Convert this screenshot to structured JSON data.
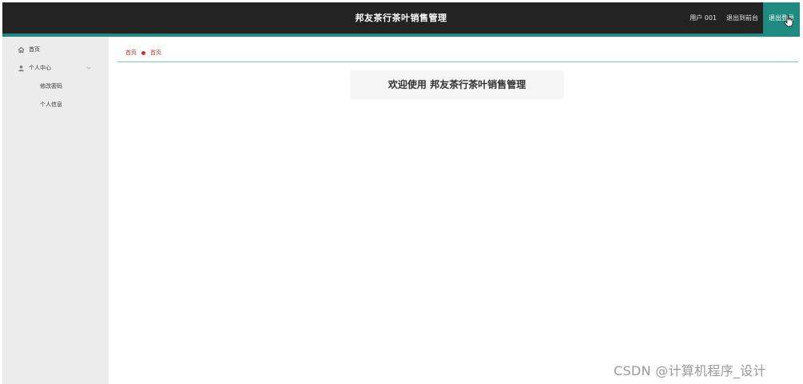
{
  "header": {
    "title": "邦友茶行茶叶销售管理",
    "user": "用户 001",
    "front_link": "退出到前台",
    "logout": "退出登录"
  },
  "sidebar": {
    "items": [
      {
        "label": "首页",
        "icon": "home-icon"
      },
      {
        "label": "个人中心",
        "icon": "user-icon",
        "expanded": true,
        "children": [
          {
            "label": "修改密码"
          },
          {
            "label": "个人信息"
          }
        ]
      }
    ]
  },
  "breadcrumb": {
    "root": "首页",
    "current": "首页"
  },
  "main": {
    "welcome": "欢迎使用 邦友茶行茶叶销售管理"
  },
  "watermark": "CSDN @计算机程序_设计",
  "colors": {
    "topbar": "#232323",
    "accent": "#1f8a80",
    "sidebar": "#ececec",
    "breadcrumb": "#c0392b"
  }
}
